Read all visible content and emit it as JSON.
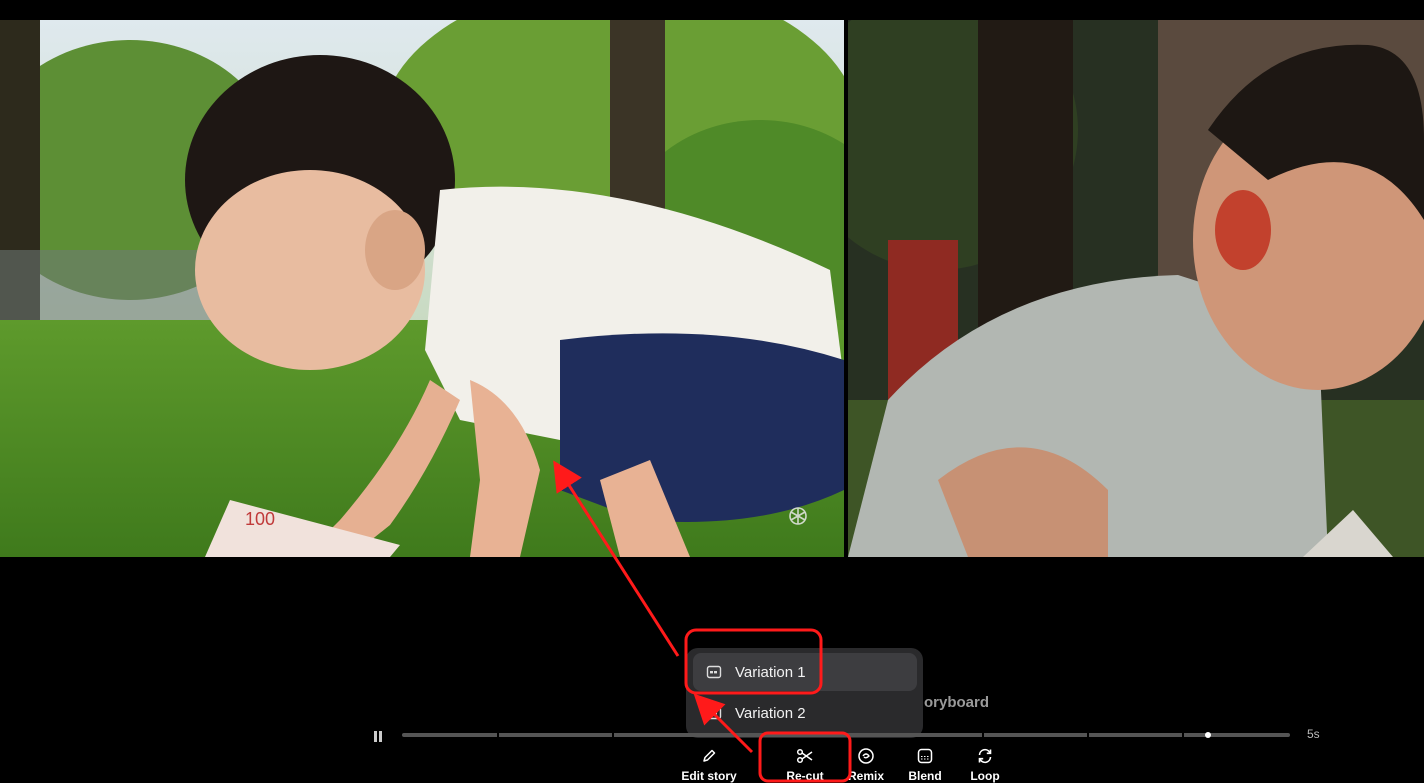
{
  "video": {
    "left_pane": "variation-preview-left",
    "right_pane": "variation-preview-right"
  },
  "menu": {
    "items": [
      {
        "label": "Variation 1",
        "icon": "clip-icon"
      },
      {
        "label": "Variation 2",
        "icon": "clip-icon"
      }
    ]
  },
  "storyboard": {
    "label": "oryboard"
  },
  "player": {
    "duration": "5s",
    "pause_icon": "pause-icon"
  },
  "toolbar": {
    "edit_story": {
      "label": "Edit story",
      "icon": "pencil-icon"
    },
    "recut": {
      "label": "Re-cut",
      "icon": "scissors-icon"
    },
    "remix": {
      "label": "Remix",
      "icon": "remix-icon"
    },
    "blend": {
      "label": "Blend",
      "icon": "blend-icon"
    },
    "loop": {
      "label": "Loop",
      "icon": "loop-icon"
    }
  },
  "colors": {
    "annotation": "#ff1a1a",
    "menu_bg": "#2a2a2c",
    "menu_active": "#3d3d40"
  }
}
